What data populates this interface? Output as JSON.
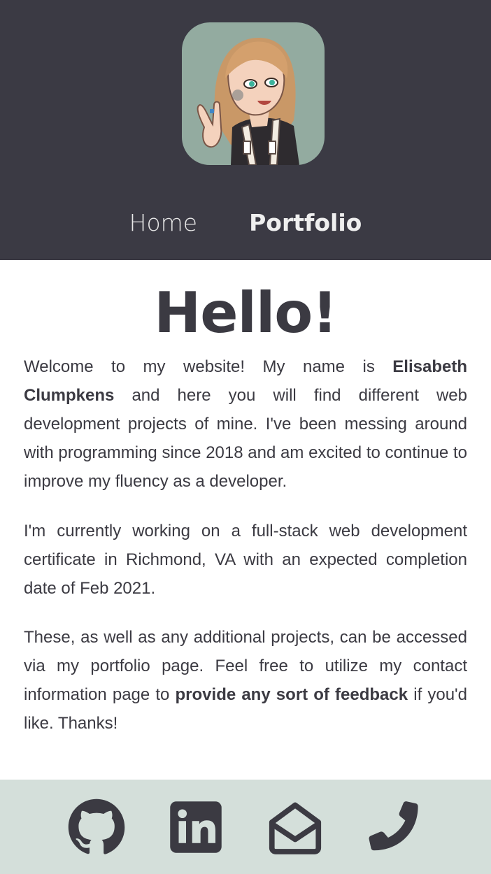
{
  "header": {
    "avatar_alt": "cartoon avatar",
    "nav": [
      {
        "label": "Home"
      },
      {
        "label": "Portfolio"
      }
    ]
  },
  "main": {
    "title": "Hello!",
    "p1": {
      "before": "Welcome to my website! My name is ",
      "name": "Elisabeth Clumpkens",
      "after": " and here you will find different web development projects of mine. I've been messing around with programming since 2018 and am excited to continue to improve my fluency as a developer."
    },
    "p2": "I'm currently working on a full-stack web development certificate in Richmond, VA with an expected completion date of Feb 2021.",
    "p3": {
      "before": "These, as well as any additional projects, can be accessed via my portfolio page. Feel free to utilize my contact information page to ",
      "highlight": "provide any sort of feedback",
      "after": " if you'd like. Thanks!"
    }
  },
  "footer": {
    "icons": [
      "github-icon",
      "linkedin-icon",
      "envelope-open-icon",
      "phone-icon"
    ]
  },
  "colors": {
    "header_bg": "#3b3a44",
    "avatar_bg": "#93aba0",
    "footer_bg": "#d4dfda",
    "text": "#3b3a42"
  }
}
